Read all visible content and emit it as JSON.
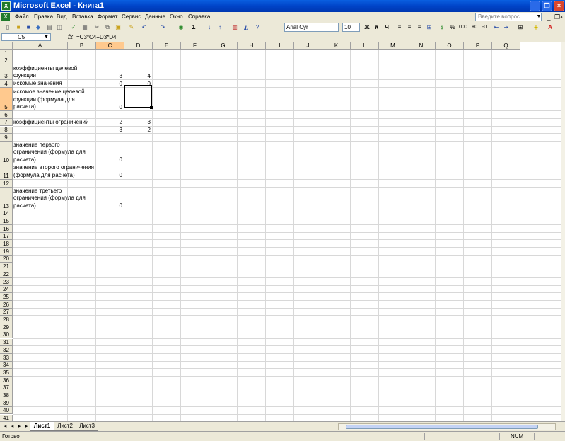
{
  "window": {
    "title": "Microsoft Excel - Книга1"
  },
  "menu": [
    "Файл",
    "Правка",
    "Вид",
    "Вставка",
    "Формат",
    "Сервис",
    "Данные",
    "Окно",
    "Справка"
  ],
  "help_placeholder": "Введите вопрос",
  "toolbar": {
    "font_name": "Arial Cyr",
    "font_size": "10",
    "sigma": "Σ",
    "bold": "Ж",
    "italic": "К",
    "underline": "Ч",
    "percent": "%",
    "thousands": "000"
  },
  "formula_bar": {
    "cell_ref": "C5",
    "fx": "fx",
    "formula": "=C3*C4+D3*D4"
  },
  "columns": [
    "A",
    "B",
    "C",
    "D",
    "E",
    "F",
    "G",
    "H",
    "I",
    "J",
    "K",
    "L",
    "M",
    "N",
    "O",
    "P",
    "Q"
  ],
  "selected_column": "C",
  "selected_row": "5",
  "rows": [
    "1",
    "2",
    "3",
    "4",
    "5",
    "6",
    "7",
    "8",
    "9",
    "10",
    "11",
    "12",
    "13",
    "14",
    "15",
    "16",
    "17",
    "18",
    "19",
    "20",
    "21",
    "22",
    "23",
    "24",
    "25",
    "26",
    "27",
    "28",
    "29",
    "30",
    "31",
    "32",
    "33",
    "34",
    "35",
    "36",
    "37",
    "38",
    "39",
    "40",
    "41"
  ],
  "cells": {
    "A3": "коэффициенты  целевой\nфункции",
    "A4": "искомые значения",
    "A5": "искомое значение целевой\nфункции (формула для\nрасчета)",
    "A7": "коэффициенты ограничений",
    "A10": "значение первого\nограничения (формула для\nрасчета)",
    "A11": "значение второго ограничения\n(формула для расчета)",
    "A13": "значение третьего\nограничения (формула для\nрасчета)",
    "C3": "3",
    "D3": "4",
    "C4": "0",
    "D4": "0",
    "C5": "0",
    "C7": "2",
    "D7": "3",
    "C8": "3",
    "D8": "2",
    "C10": "0",
    "C11": "0",
    "C13": "0"
  },
  "sheets": [
    "Лист1",
    "Лист2",
    "Лист3"
  ],
  "active_sheet": "Лист1",
  "status": {
    "left": "Готово",
    "num": "NUM"
  }
}
